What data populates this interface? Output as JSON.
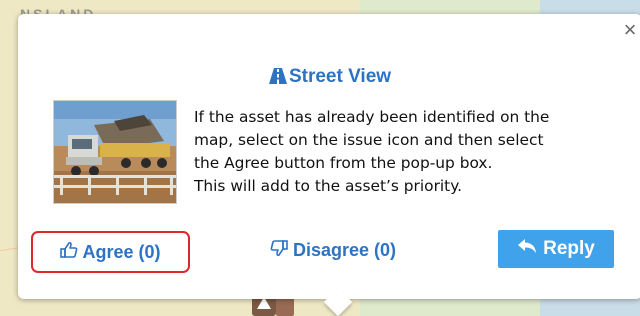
{
  "map": {
    "region_label": "NSLAND"
  },
  "popup": {
    "close_glyph": "×",
    "title": "Street View",
    "title_icon": "road-icon",
    "photo_alt": "truck-on-bridge-photo",
    "description_lines": [
      "If the asset has already been identified on the",
      "map, select on the issue icon and then select",
      "the Agree button from the pop-up box.",
      "This will add to the asset’s priority."
    ],
    "agree_label": "Agree (0)",
    "disagree_label": "Disagree (0)",
    "reply_label": "Reply",
    "colors": {
      "accent": "#2d73c4",
      "highlight_border": "#e0262d",
      "reply_bg": "#3fa2ea"
    }
  }
}
